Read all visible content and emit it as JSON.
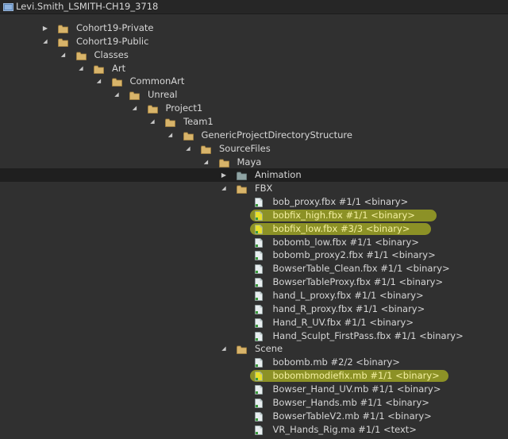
{
  "root": {
    "label": "Levi.Smith_LSMITH-CH19_3718",
    "icon": "workspace-icon"
  },
  "rows": [
    {
      "label": "Cohort19-Private",
      "type": "folder",
      "depth": 0,
      "expanded": false
    },
    {
      "label": "Cohort19-Public",
      "type": "folder",
      "depth": 0,
      "expanded": true
    },
    {
      "label": "Classes",
      "type": "folder",
      "depth": 1,
      "expanded": true
    },
    {
      "label": "Art",
      "type": "folder",
      "depth": 2,
      "expanded": true
    },
    {
      "label": "CommonArt",
      "type": "folder",
      "depth": 3,
      "expanded": true
    },
    {
      "label": "Unreal",
      "type": "folder",
      "depth": 4,
      "expanded": true
    },
    {
      "label": "Project1",
      "type": "folder",
      "depth": 5,
      "expanded": true
    },
    {
      "label": "Team1",
      "type": "folder",
      "depth": 6,
      "expanded": true
    },
    {
      "label": "GenericProjectDirectoryStructure",
      "type": "folder",
      "depth": 7,
      "expanded": true
    },
    {
      "label": "SourceFiles",
      "type": "folder",
      "depth": 8,
      "expanded": true
    },
    {
      "label": "Maya",
      "type": "folder",
      "depth": 9,
      "expanded": true
    },
    {
      "label": "Animation",
      "type": "folder-grey",
      "depth": 10,
      "expanded": false,
      "selected": true
    },
    {
      "label": "FBX",
      "type": "folder",
      "depth": 10,
      "expanded": true
    },
    {
      "label": "bob_proxy.fbx #1/1 <binary>",
      "type": "file",
      "depth": 11
    },
    {
      "label": "bobfix_high.fbx #1/1 <binary>",
      "type": "file-yellow",
      "depth": 11,
      "highlight": true
    },
    {
      "label": "bobfix_low.fbx #3/3 <binary>",
      "type": "file-yellow",
      "depth": 11,
      "highlight": true
    },
    {
      "label": "bobomb_low.fbx #1/1 <binary>",
      "type": "file",
      "depth": 11
    },
    {
      "label": "bobomb_proxy2.fbx #1/1 <binary>",
      "type": "file",
      "depth": 11
    },
    {
      "label": "BowserTable_Clean.fbx #1/1 <binary>",
      "type": "file",
      "depth": 11
    },
    {
      "label": "BowserTableProxy.fbx #1/1 <binary>",
      "type": "file",
      "depth": 11
    },
    {
      "label": "hand_L_proxy.fbx #1/1 <binary>",
      "type": "file",
      "depth": 11
    },
    {
      "label": "hand_R_proxy.fbx #1/1 <binary>",
      "type": "file",
      "depth": 11
    },
    {
      "label": "Hand_R_UV.fbx #1/1 <binary>",
      "type": "file",
      "depth": 11
    },
    {
      "label": "Hand_Sculpt_FirstPass.fbx #1/1 <binary>",
      "type": "file",
      "depth": 11
    },
    {
      "label": "Scene",
      "type": "folder",
      "depth": 10,
      "expanded": true
    },
    {
      "label": "bobomb.mb #2/2 <binary>",
      "type": "file",
      "depth": 11
    },
    {
      "label": "bobombmodiefix.mb #1/1 <binary>",
      "type": "file-yellow",
      "depth": 11,
      "highlight": true
    },
    {
      "label": "Bowser_Hand_UV.mb #1/1 <binary>",
      "type": "file",
      "depth": 11
    },
    {
      "label": "Bowser_Hands.mb #1/1 <binary>",
      "type": "file",
      "depth": 11
    },
    {
      "label": "BowserTableV2.mb #1/1 <binary>",
      "type": "file",
      "depth": 11
    },
    {
      "label": "VR_Hands_Rig.ma #1/1 <text>",
      "type": "file",
      "depth": 11
    }
  ],
  "colors": {
    "background": "#303030",
    "folder": "#d8b46a",
    "folder_grey": "#8fa3a3",
    "file_yellow": "#e8e02a",
    "highlight": "#d9e21f"
  }
}
